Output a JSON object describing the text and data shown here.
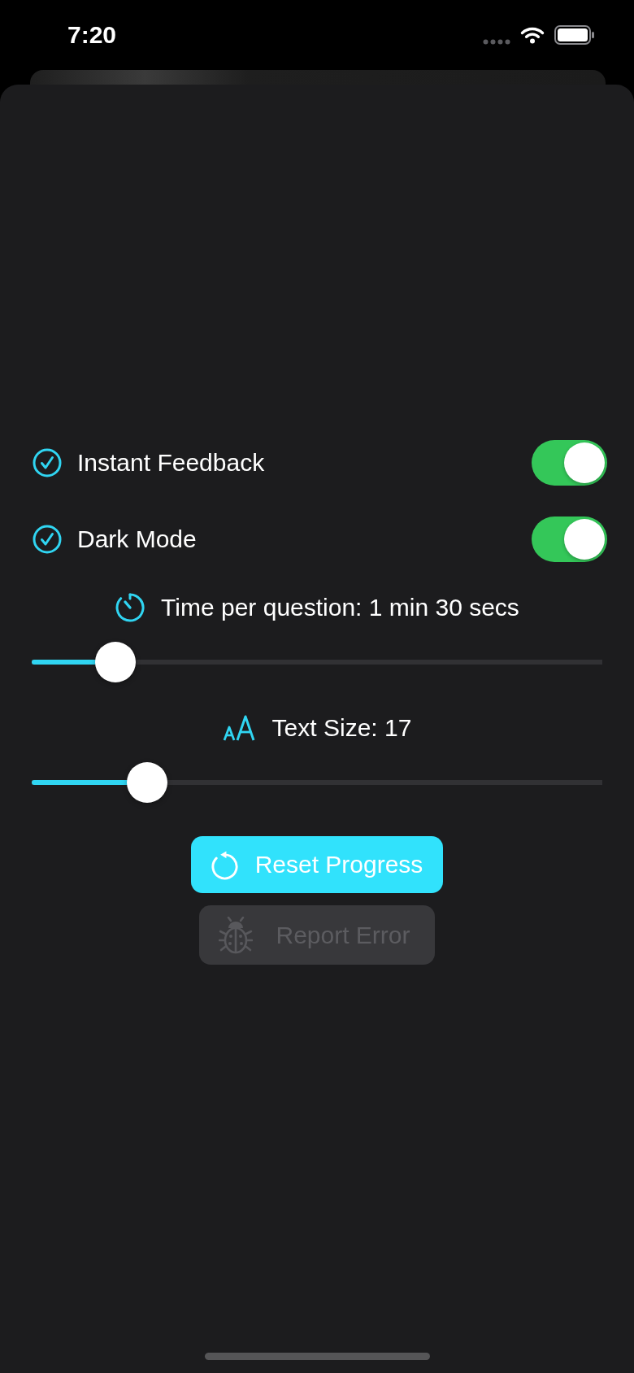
{
  "status_bar": {
    "time": "7:20"
  },
  "settings": {
    "toggles": [
      {
        "label": "Instant Feedback",
        "on": true
      },
      {
        "label": "Dark Mode",
        "on": true
      }
    ],
    "sliders": [
      {
        "kind": "timer",
        "label": "Time per question: 1 min 30 secs",
        "level": 0.12
      },
      {
        "kind": "text-size",
        "label": "Text Size: 17",
        "level": 0.18
      }
    ]
  },
  "buttons": [
    {
      "kind": "reset",
      "label": "Reset Progress",
      "disabled": false
    },
    {
      "kind": "bug",
      "label": "Report Error",
      "disabled": true
    }
  ]
}
